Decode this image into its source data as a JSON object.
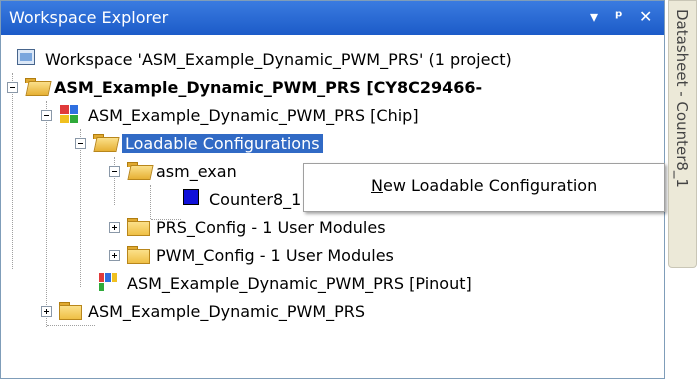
{
  "panel": {
    "title": "Workspace Explorer",
    "buttons": {
      "dropdown": "▾",
      "pin": "ᵖ",
      "close": "✕"
    }
  },
  "tree": {
    "workspace": "Workspace 'ASM_Example_Dynamic_PWM_PRS' (1 project)",
    "project": "ASM_Example_Dynamic_PWM_PRS [CY8C29466-",
    "chip": "ASM_Example_Dynamic_PWM_PRS [Chip]",
    "loadable": "Loadable Configurations",
    "asm_config": "asm_exan",
    "counter": "Counter8_1",
    "prs": "PRS_Config - 1 User Modules",
    "pwm": "PWM_Config - 1 User Modules",
    "pinout": "ASM_Example_Dynamic_PWM_PRS [Pinout]",
    "root_folder": "ASM_Example_Dynamic_PWM_PRS"
  },
  "context_menu": {
    "item_pre": "",
    "item_accel": "N",
    "item_post": "ew Loadable Configuration"
  },
  "side_tab": {
    "label": "Datasheet - Counter8_1"
  },
  "colors": {
    "selection": "#316ac5",
    "titlebar": "#1c5bc8",
    "counter_square": "#1010d8"
  }
}
